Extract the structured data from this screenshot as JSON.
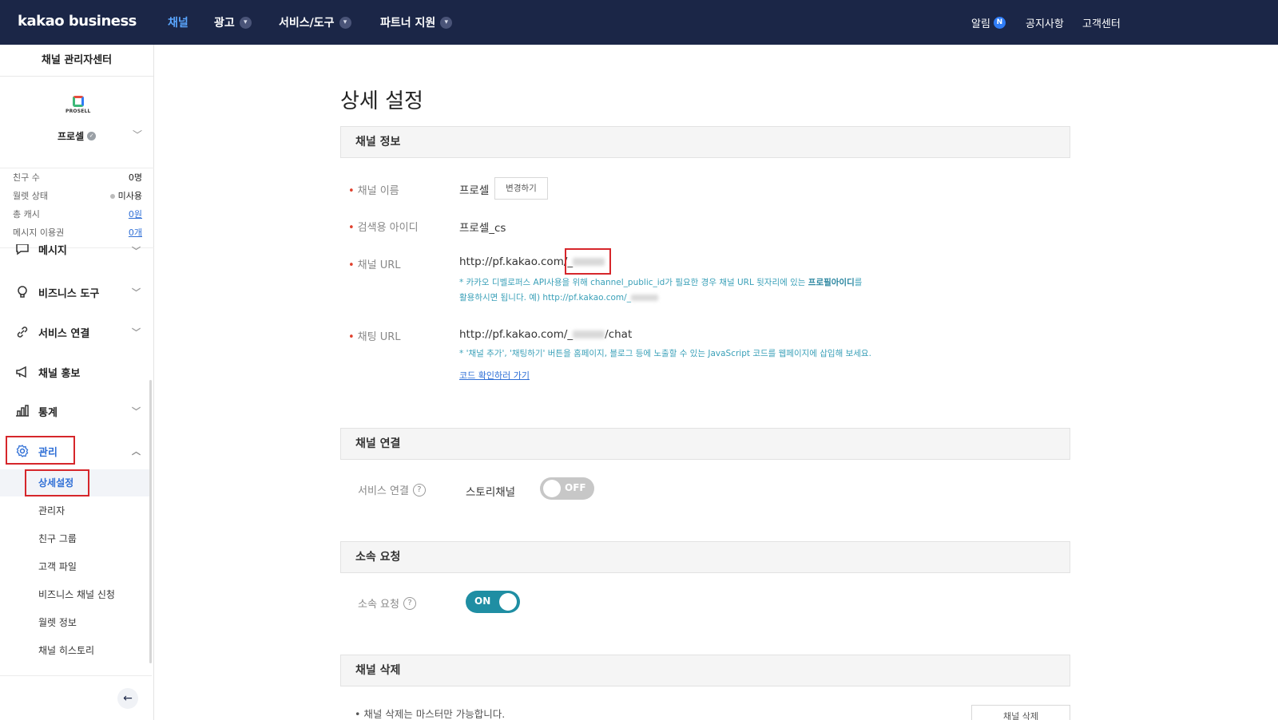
{
  "header": {
    "logo": "kakao business",
    "nav": [
      {
        "label": "채널"
      },
      {
        "label": "광고"
      },
      {
        "label": "서비스/도구"
      },
      {
        "label": "파트너 지원"
      }
    ],
    "util": {
      "alarm": "알림",
      "badge": "N",
      "notice": "공지사항",
      "support": "고객센터"
    }
  },
  "sidebar": {
    "title": "채널 관리자센터",
    "profile": {
      "logo_text": "PROSELL",
      "name": "프로셀"
    },
    "stats": [
      {
        "label": "친구 수",
        "value": "0명"
      },
      {
        "label": "월렛 상태",
        "value": "미사용"
      },
      {
        "label": "총 캐시",
        "value": "0원"
      },
      {
        "label": "메시지 이용권",
        "value": "0개"
      }
    ],
    "menu": [
      {
        "label": "메시지"
      },
      {
        "label": "비즈니스 도구"
      },
      {
        "label": "서비스 연결"
      },
      {
        "label": "채널 홍보"
      },
      {
        "label": "통계"
      },
      {
        "label": "관리"
      }
    ],
    "submenu": [
      {
        "label": "상세설정"
      },
      {
        "label": "관리자"
      },
      {
        "label": "친구 그룹"
      },
      {
        "label": "고객 파일"
      },
      {
        "label": "비즈니스 채널 신청"
      },
      {
        "label": "월렛 정보"
      },
      {
        "label": "채널 히스토리"
      }
    ]
  },
  "main": {
    "title": "상세 설정",
    "channel_info": {
      "section": "채널 정보",
      "name_label": "채널 이름",
      "name_value": "프로셀",
      "change_button": "변경하기",
      "search_id_label": "검색용 아이디",
      "search_id_value": "프로셀_cs",
      "url_label": "채널 URL",
      "url_prefix": "http://pf.kakao.com/_",
      "url_note_1": "* 카카오 디벨로퍼스 API사용을 위해 channel_public_id가 필요한 경우 채널 URL 뒷자리에 있는",
      "url_note_bold": "프로필아이디",
      "url_note_1_end": "를",
      "url_note_2": "활용하시면 됩니다. 예) http://pf.kakao.com/_",
      "chat_label": "채팅 URL",
      "chat_prefix": "http://pf.kakao.com/_",
      "chat_suffix": "/chat",
      "chat_note": "* '채널 추가', '채팅하기' 버튼을 홈페이지, 블로그 등에 노출할 수 있는 JavaScript 코드를 웹페이지에 삽입해 보세요.",
      "code_link": "코드 확인하러 가기"
    },
    "channel_link": {
      "section": "채널 연결",
      "label": "서비스 연결",
      "service": "스토리채널",
      "toggle": "OFF"
    },
    "affiliation": {
      "section": "소속 요청",
      "label": "소속 요청",
      "toggle": "ON"
    },
    "delete": {
      "section": "채널 삭제",
      "note": "채널 삭제는 마스터만 가능합니다.",
      "button": "채널 삭제"
    }
  }
}
